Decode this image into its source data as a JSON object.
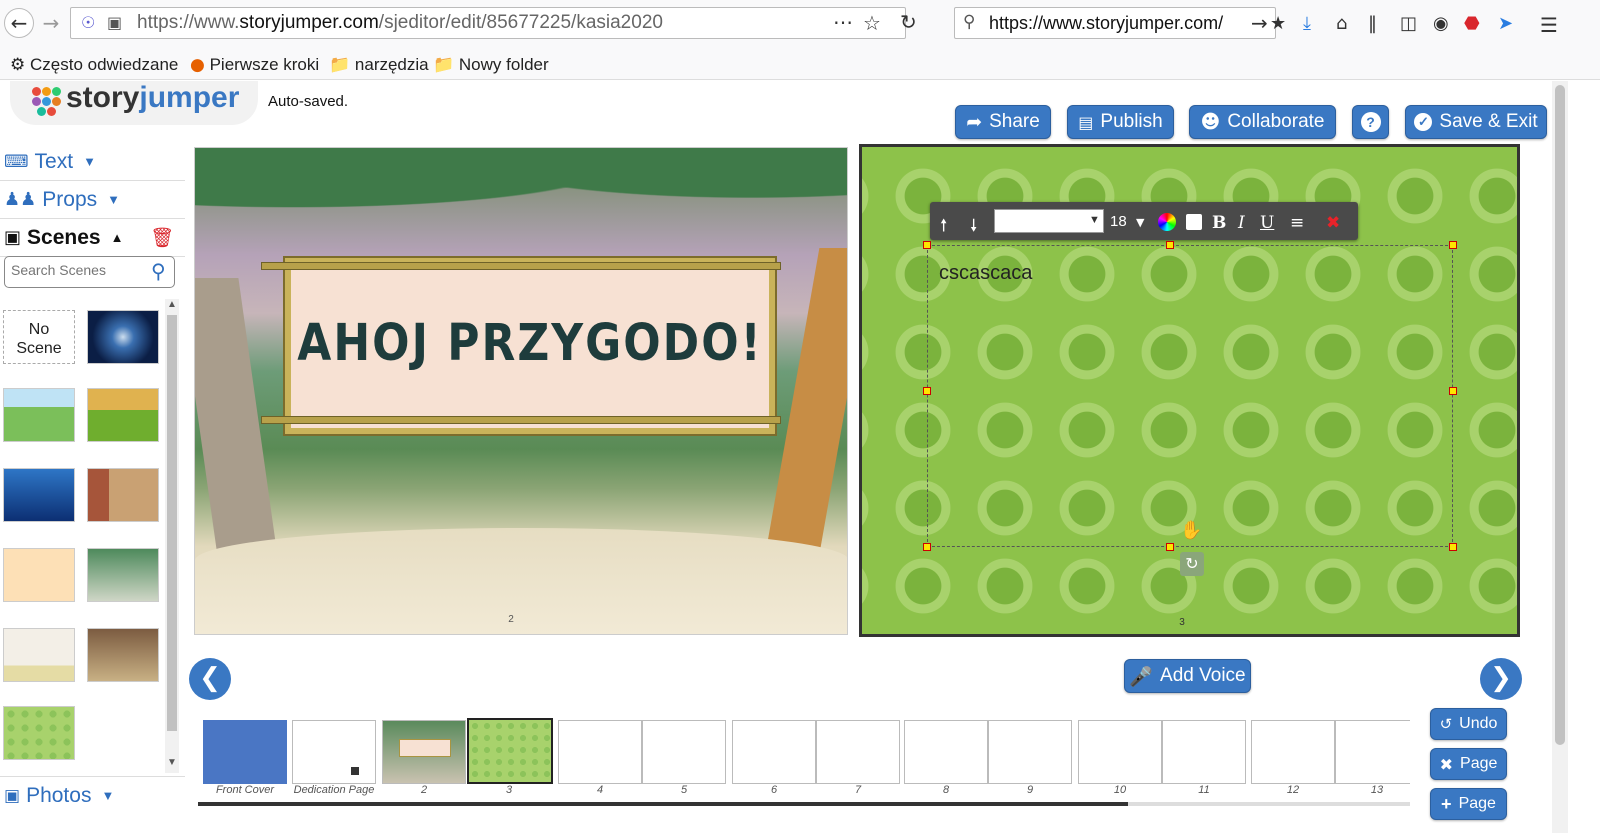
{
  "browser": {
    "url_prefix": "https://www.",
    "url_domain": "storyjumper.com",
    "url_path": "/sjeditor/edit/85677225/kasia2020",
    "search_value": "https://www.storyjumper.com/",
    "bookmarks": [
      "Często odwiedzane",
      "Pierwsze kroki",
      "narzędzia",
      "Nowy folder"
    ]
  },
  "header": {
    "logo_story": "story",
    "logo_jumper": "jumper",
    "status": "Auto-saved.",
    "buttons": {
      "share": "Share",
      "publish": "Publish",
      "collaborate": "Collaborate",
      "help": "?",
      "save_exit": "Save & Exit"
    }
  },
  "sidebar": {
    "text_label": "Text",
    "props_label": "Props",
    "scenes_label": "Scenes",
    "search_placeholder": "Search Scenes",
    "no_scene_line1": "No",
    "no_scene_line2": "Scene",
    "photos_label": "Photos"
  },
  "editor": {
    "left_page_title": "AHOJ PRZYGODO!",
    "left_page_number": "2",
    "right_page_number": "3",
    "textbox_value": "cscascaca",
    "font_size": "18",
    "add_voice": "Add Voice"
  },
  "pages": [
    {
      "label": "Front Cover"
    },
    {
      "label": "Dedication Page"
    },
    {
      "label": "2"
    },
    {
      "label": "3"
    },
    {
      "label": "4"
    },
    {
      "label": "5"
    },
    {
      "label": "6"
    },
    {
      "label": "7"
    },
    {
      "label": "8"
    },
    {
      "label": "9"
    },
    {
      "label": "10"
    },
    {
      "label": "11"
    },
    {
      "label": "12"
    },
    {
      "label": "13"
    }
  ],
  "page_controls": {
    "undo": "Undo",
    "delete_page": "Page",
    "add_page": "Page"
  },
  "colors": {
    "accent": "#3a78c3",
    "red": "#d9262c",
    "green_bg": "#8dc24a"
  }
}
